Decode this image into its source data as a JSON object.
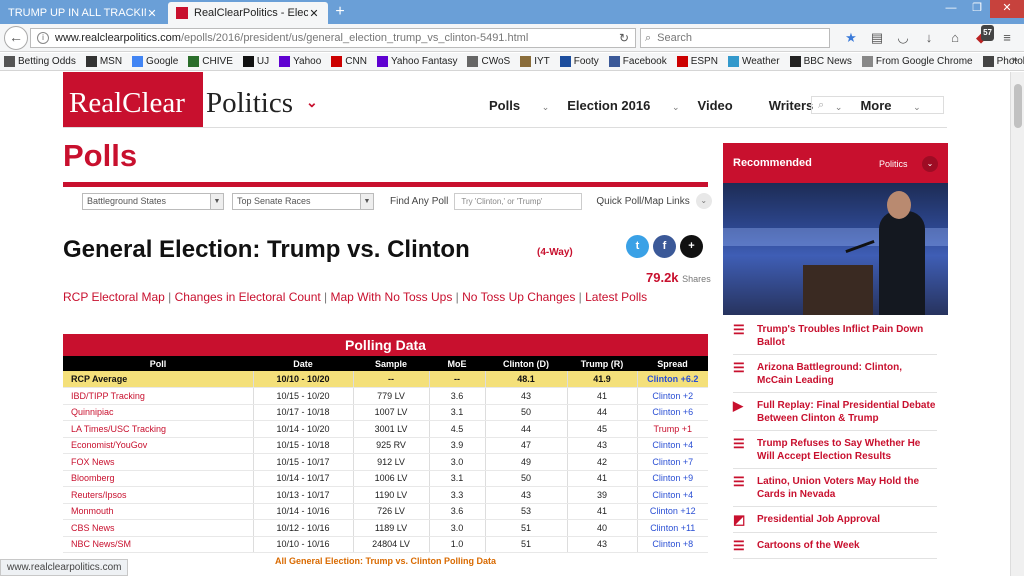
{
  "browser": {
    "tabs": [
      {
        "title": "TRUMP UP IN ALL TRACKING ..."
      },
      {
        "title": "RealClearPolitics - Electio..."
      }
    ],
    "url_domain": "www.realclearpolitics.com",
    "url_path": "/epolls/2016/president/us/general_election_trump_vs_clinton-5491.html",
    "search_placeholder": "Search",
    "notification_count": "57",
    "bookmarks": [
      {
        "label": "Betting Odds",
        "color": "#555555"
      },
      {
        "label": "MSN",
        "color": "#333333"
      },
      {
        "label": "Google",
        "color": "#4285f4"
      },
      {
        "label": "CHIVE",
        "color": "#2b6e2b"
      },
      {
        "label": "UJ",
        "color": "#111111"
      },
      {
        "label": "Yahoo",
        "color": "#5f01d1"
      },
      {
        "label": "CNN",
        "color": "#cc0000"
      },
      {
        "label": "Yahoo Fantasy",
        "color": "#5f01d1"
      },
      {
        "label": "CWoS",
        "color": "#666666"
      },
      {
        "label": "IYT",
        "color": "#8a6d3b"
      },
      {
        "label": "Footy",
        "color": "#1d4e9e"
      },
      {
        "label": "Facebook",
        "color": "#3b5998"
      },
      {
        "label": "ESPN",
        "color": "#cc0000"
      },
      {
        "label": "Weather",
        "color": "#3399cc"
      },
      {
        "label": "BBC News",
        "color": "#222222"
      },
      {
        "label": "From Google Chrome",
        "color": "#888888"
      },
      {
        "label": "Photobucket",
        "color": "#444444"
      }
    ],
    "status_url": "www.realclearpolitics.com"
  },
  "site": {
    "logo_realclear": "RealClear",
    "logo_politics": "Politics",
    "nav": [
      "Polls",
      "Election 2016",
      "Video",
      "Writers",
      "More"
    ]
  },
  "page": {
    "section_title": "Polls",
    "filters": {
      "select1": "Battleground States",
      "select2": "Top Senate Races",
      "find_label": "Find Any Poll",
      "find_placeholder": "Try 'Clinton,' or 'Trump'",
      "quick_label": "Quick Poll/Map Links"
    },
    "headline": "General Election: Trump vs. Clinton",
    "headline_tag": "(4-Way)",
    "shares_count": "79.2k",
    "shares_label": "Shares",
    "links": [
      "RCP Electoral Map",
      "Changes in Electoral Count",
      "Map With No Toss Ups",
      "No Toss Up Changes",
      "Latest Polls"
    ],
    "table_title": "Polling Data",
    "table_headers": [
      "Poll",
      "Date",
      "Sample",
      "MoE",
      "Clinton (D)",
      "Trump (R)",
      "Spread"
    ],
    "average_row": [
      "RCP Average",
      "10/10 - 10/20",
      "--",
      "--",
      "48.1",
      "41.9",
      "Clinton +6.2"
    ],
    "rows": [
      [
        "IBD/TIPP Tracking",
        "10/15 - 10/20",
        "779 LV",
        "3.6",
        "43",
        "41",
        "Clinton +2"
      ],
      [
        "Quinnipiac",
        "10/17 - 10/18",
        "1007 LV",
        "3.1",
        "50",
        "44",
        "Clinton +6"
      ],
      [
        "LA Times/USC Tracking",
        "10/14 - 10/20",
        "3001 LV",
        "4.5",
        "44",
        "45",
        "Trump +1"
      ],
      [
        "Economist/YouGov",
        "10/15 - 10/18",
        "925 RV",
        "3.9",
        "47",
        "43",
        "Clinton +4"
      ],
      [
        "FOX News",
        "10/15 - 10/17",
        "912 LV",
        "3.0",
        "49",
        "42",
        "Clinton +7"
      ],
      [
        "Bloomberg",
        "10/14 - 10/17",
        "1006 LV",
        "3.1",
        "50",
        "41",
        "Clinton +9"
      ],
      [
        "Reuters/Ipsos",
        "10/13 - 10/17",
        "1190 LV",
        "3.3",
        "43",
        "39",
        "Clinton +4"
      ],
      [
        "Monmouth",
        "10/14 - 10/16",
        "726 LV",
        "3.6",
        "53",
        "41",
        "Clinton +12"
      ],
      [
        "CBS News",
        "10/12 - 10/16",
        "1189 LV",
        "3.0",
        "51",
        "40",
        "Clinton +11"
      ],
      [
        "NBC News/SM",
        "10/10 - 10/16",
        "24804 LV",
        "1.0",
        "51",
        "43",
        "Clinton +8"
      ]
    ],
    "all_data_link": "All General Election: Trump vs. Clinton Polling Data"
  },
  "sidebar": {
    "title": "Recommended",
    "category": "Politics",
    "items": [
      {
        "icon": "list-icon",
        "text": "Trump's Troubles Inflict Pain Down Ballot"
      },
      {
        "icon": "list-icon",
        "text": "Arizona Battleground: Clinton, McCain Leading"
      },
      {
        "icon": "video-icon",
        "text": "Full Replay: Final Presidential Debate Between Clinton & Trump"
      },
      {
        "icon": "list-icon",
        "text": "Trump Refuses to Say Whether He Will Accept Election Results"
      },
      {
        "icon": "list-icon",
        "text": "Latino, Union Voters May Hold the Cards in Nevada"
      },
      {
        "icon": "chart-icon",
        "text": "Presidential Job Approval"
      },
      {
        "icon": "list-icon",
        "text": "Cartoons of the Week"
      }
    ]
  },
  "colors": {
    "brand_red": "#c8102e",
    "spread_blue": "#2a4fd4",
    "average_yellow": "#f4e07a"
  }
}
